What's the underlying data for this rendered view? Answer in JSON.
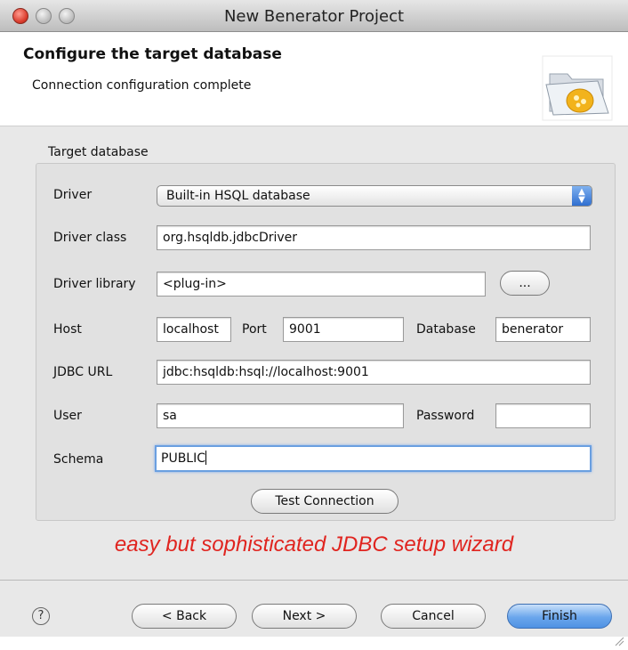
{
  "window": {
    "title": "New Benerator Project"
  },
  "header": {
    "title": "Configure the target database",
    "subtitle": "Connection configuration complete"
  },
  "group": {
    "label": "Target database"
  },
  "form": {
    "driver": {
      "label": "Driver",
      "value": "Built-in HSQL database"
    },
    "driver_class": {
      "label": "Driver class",
      "value": "org.hsqldb.jdbcDriver"
    },
    "driver_library": {
      "label": "Driver library",
      "value": "<plug-in>",
      "browse_label": "..."
    },
    "host": {
      "label": "Host",
      "value": "localhost"
    },
    "port": {
      "label": "Port",
      "value": "9001"
    },
    "database": {
      "label": "Database",
      "value": "benerator"
    },
    "jdbc_url": {
      "label": "JDBC URL",
      "value": "jdbc:hsqldb:hsql://localhost:9001"
    },
    "user": {
      "label": "User",
      "value": "sa"
    },
    "password": {
      "label": "Password",
      "value": ""
    },
    "schema": {
      "label": "Schema",
      "value": "PUBLIC"
    },
    "test_connection_label": "Test Connection"
  },
  "promo_text": "easy but sophisticated JDBC setup wizard",
  "footer": {
    "help_symbol": "?",
    "back_label": "< Back",
    "next_label": "Next >",
    "cancel_label": "Cancel",
    "finish_label": "Finish"
  },
  "colors": {
    "promo": "#e0241f",
    "primary_button": "#4f92e3",
    "focus_ring": "#6a9fe0"
  },
  "icons": [
    "close-icon",
    "minimize-icon",
    "zoom-icon",
    "wizard-folder-icon",
    "select-arrows-icon",
    "help-icon",
    "resize-grip-icon"
  ]
}
